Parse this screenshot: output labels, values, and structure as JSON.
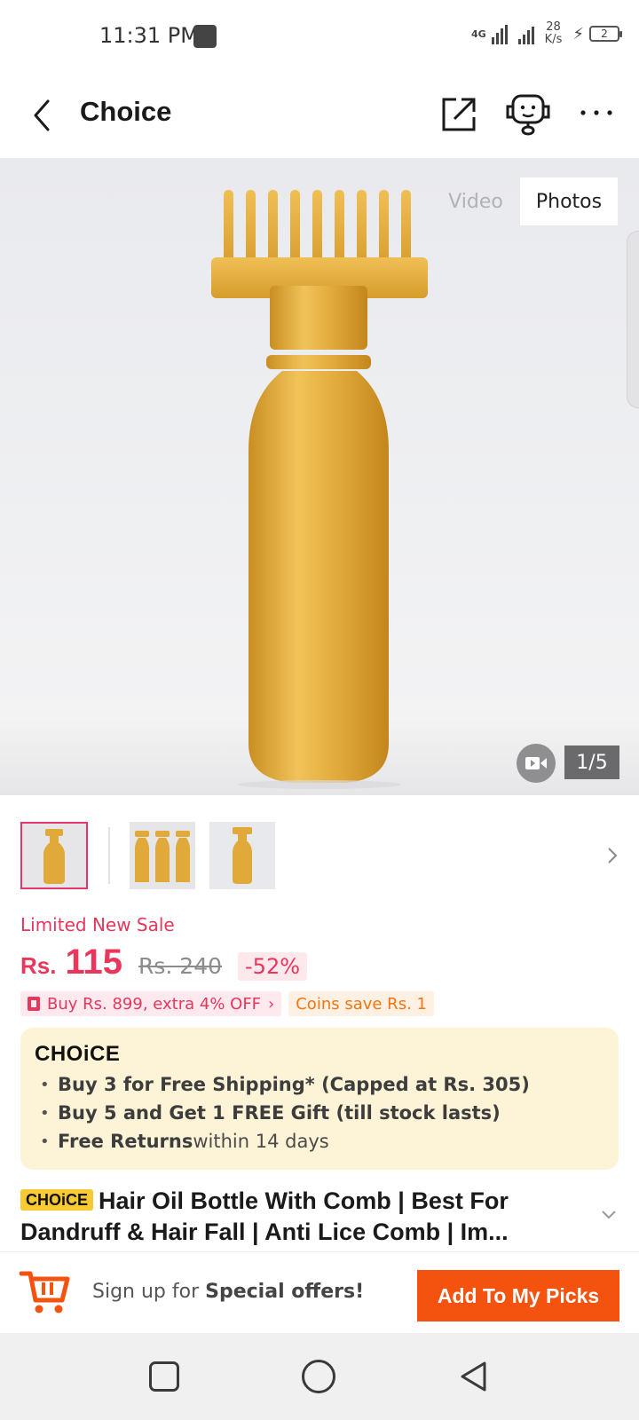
{
  "status_bar": {
    "time": "11:31 PM",
    "network": "4G",
    "speed_value": "28",
    "speed_unit": "K/s",
    "battery": "2"
  },
  "header": {
    "title": "Choice",
    "icons": [
      "back-icon",
      "share-icon",
      "customer-support-icon",
      "more-icon"
    ]
  },
  "gallery": {
    "video_tab": "Video",
    "photos_tab": "Photos",
    "active_tab": "Photos",
    "counter": "1/5",
    "thumbnail_count": 3,
    "selected_thumbnail": 1
  },
  "pricing": {
    "sale_label": "Limited New Sale",
    "currency": "Rs.",
    "price": "115",
    "original_price": "Rs. 240",
    "discount": "-52%",
    "promo": "Buy Rs. 899, extra 4% OFF",
    "coins": "Coins save Rs. 1"
  },
  "choice": {
    "logo": "CHOiCE",
    "benefits": [
      {
        "bold": "Buy 3 for  Free Shipping* (Capped at Rs. 305)",
        "rest": ""
      },
      {
        "bold": "Buy 5 and Get 1 FREE Gift (till stock lasts)",
        "rest": ""
      },
      {
        "bold": "Free Returns",
        "rest": " within 14 days"
      }
    ]
  },
  "product": {
    "badge": "CHOiCE",
    "title": "Hair Oil Bottle With Comb | Best For Dandruff & Hair Fall | Anti Lice Comb | Im..."
  },
  "action_bar": {
    "signup_prefix": "Sign up for ",
    "signup_bold": "Special offers!",
    "cta": "Add To My Picks"
  },
  "colors": {
    "accent_pink": "#e8365d",
    "cta_orange": "#f4530f",
    "choice_bg": "#fdf3d7",
    "choice_badge": "#f7c932",
    "bottle_gold": "#e0a93a"
  }
}
